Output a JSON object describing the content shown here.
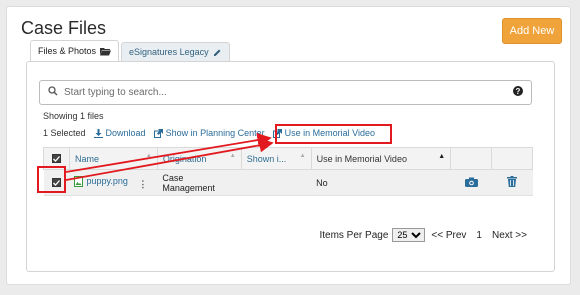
{
  "header": {
    "title": "Case Files",
    "add_new_label": "Add New"
  },
  "tabs": [
    {
      "label": "Files & Photos",
      "icon": "folder-open-icon",
      "active": true
    },
    {
      "label": "eSignatures Legacy",
      "icon": "pencil-icon",
      "active": false
    }
  ],
  "search": {
    "placeholder": "Start typing to search...",
    "value": ""
  },
  "status": {
    "showing": "Showing 1 files",
    "selected": "1 Selected"
  },
  "actions": {
    "download": "Download",
    "planning": "Show in Planning Center",
    "memorial": "Use in Memorial Video"
  },
  "table": {
    "columns": [
      "Name",
      "Origination",
      "Shown i...",
      "Use in Memorial Video"
    ],
    "rows": [
      {
        "name": "puppy.png",
        "origination": "Case Management",
        "shown": "",
        "memorial": "No",
        "checked": true
      }
    ]
  },
  "pager": {
    "items_per_page_label": "Items Per Page",
    "per_page_value": "25",
    "prev_label": "<< Prev",
    "page": "1",
    "next_label": "Next >>"
  },
  "colors": {
    "accent": "#f0a33a",
    "link": "#2a6c9a",
    "annotation": "#e2191f"
  }
}
